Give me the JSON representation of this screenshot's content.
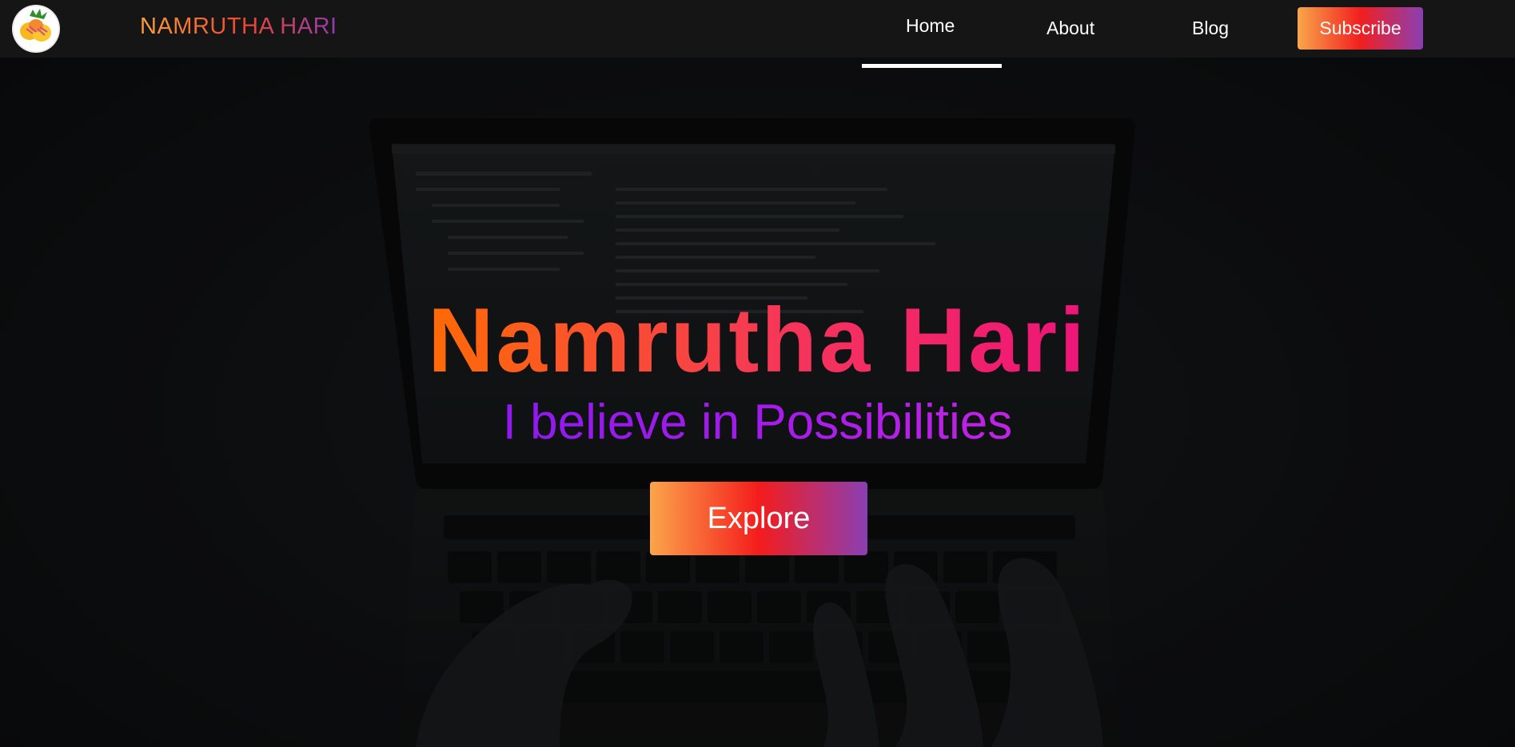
{
  "nav": {
    "brand": "NAMRUTHA HARI",
    "links": [
      {
        "label": "Home",
        "active": true
      },
      {
        "label": "About",
        "active": false
      },
      {
        "label": "Blog",
        "active": false
      }
    ],
    "subscribe_label": "Subscribe"
  },
  "hero": {
    "title": "Namrutha Hari",
    "subtitle": "I believe in Possibilities",
    "cta_label": "Explore"
  },
  "colors": {
    "navbar_bg": "#161616",
    "page_bg": "#0d0f11",
    "title_gradient": [
      "#ff6a06",
      "#ee1479"
    ],
    "subtitle_gradient": [
      "#8f1aee",
      "#c024e3"
    ],
    "button_gradient": [
      "#fba54a",
      "#f41c1c",
      "#8a3fb3"
    ]
  },
  "icons": {
    "logo": "fruit-logo-icon"
  }
}
